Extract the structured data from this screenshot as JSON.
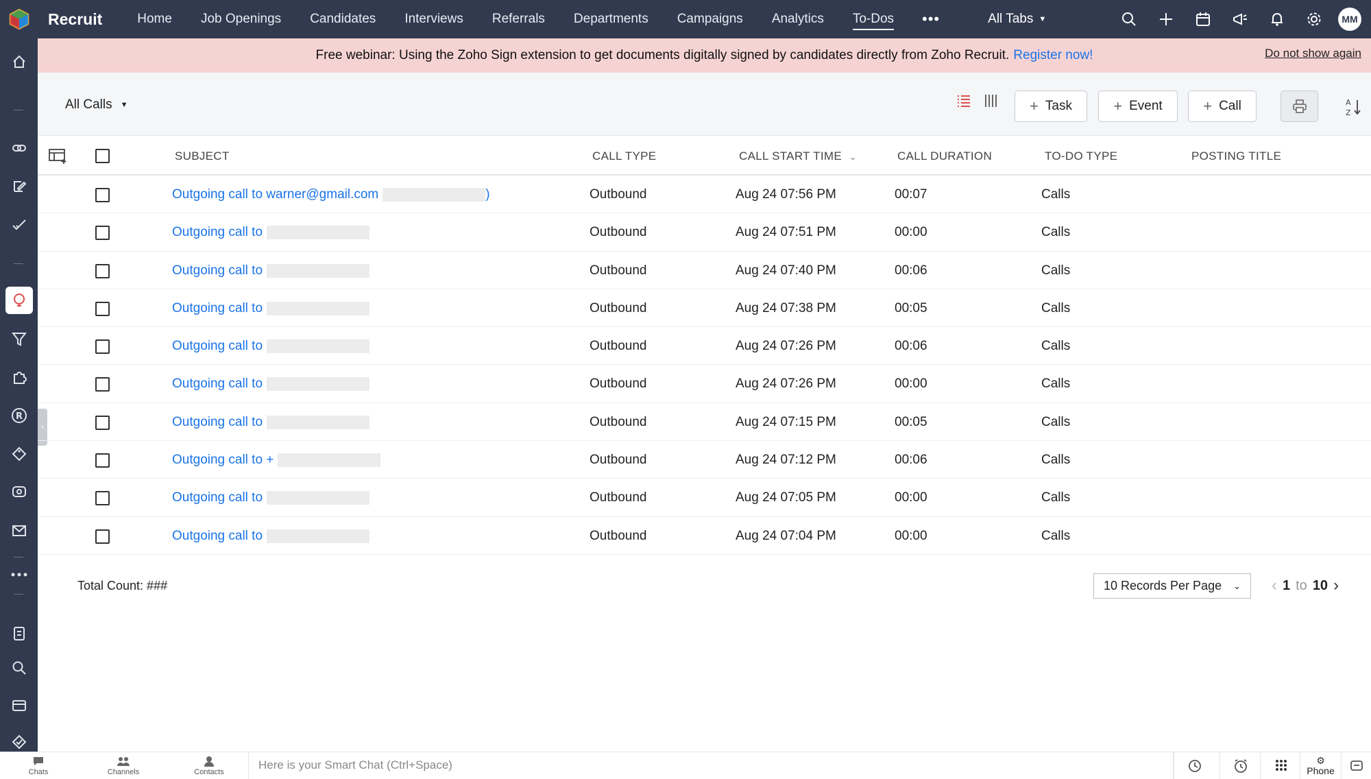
{
  "app": {
    "brand": "Recruit",
    "user_initials": "MM"
  },
  "nav": {
    "items": [
      "Home",
      "Job Openings",
      "Candidates",
      "Interviews",
      "Referrals",
      "Departments",
      "Campaigns",
      "Analytics",
      "To-Dos"
    ],
    "active": "To-Dos",
    "more": "•••",
    "all_tabs": "All Tabs"
  },
  "banner": {
    "text": "Free webinar: Using the Zoho Sign extension to get documents digitally signed by candidates directly from Zoho Recruit.",
    "link": "Register now!",
    "dismiss": "Do not show again"
  },
  "toolbar": {
    "view": "All Calls",
    "task_label": "Task",
    "event_label": "Event",
    "call_label": "Call"
  },
  "table": {
    "headers": {
      "subject": "SUBJECT",
      "call_type": "CALL TYPE",
      "call_start_time": "CALL START TIME",
      "call_duration": "CALL DURATION",
      "todo_type": "TO-DO TYPE",
      "posting_title": "POSTING TITLE"
    },
    "rows": [
      {
        "subject": "Outgoing call to warner@gmail.com",
        "suffix": ")",
        "call_type": "Outbound",
        "start": "Aug 24 07:56 PM",
        "duration": "00:07",
        "todo": "Calls"
      },
      {
        "subject": "Outgoing call to",
        "suffix": "",
        "call_type": "Outbound",
        "start": "Aug 24 07:51 PM",
        "duration": "00:00",
        "todo": "Calls"
      },
      {
        "subject": "Outgoing call to",
        "suffix": "",
        "call_type": "Outbound",
        "start": "Aug 24 07:40 PM",
        "duration": "00:06",
        "todo": "Calls"
      },
      {
        "subject": "Outgoing call to",
        "suffix": "",
        "call_type": "Outbound",
        "start": "Aug 24 07:38 PM",
        "duration": "00:05",
        "todo": "Calls"
      },
      {
        "subject": "Outgoing call to",
        "suffix": "",
        "call_type": "Outbound",
        "start": "Aug 24 07:26 PM",
        "duration": "00:06",
        "todo": "Calls"
      },
      {
        "subject": "Outgoing call to",
        "suffix": "",
        "call_type": "Outbound",
        "start": "Aug 24 07:26 PM",
        "duration": "00:00",
        "todo": "Calls"
      },
      {
        "subject": "Outgoing call to",
        "suffix": "",
        "call_type": "Outbound",
        "start": "Aug 24 07:15 PM",
        "duration": "00:05",
        "todo": "Calls"
      },
      {
        "subject": "Outgoing call to +",
        "suffix": "",
        "call_type": "Outbound",
        "start": "Aug 24 07:12 PM",
        "duration": "00:06",
        "todo": "Calls"
      },
      {
        "subject": "Outgoing call to",
        "suffix": "",
        "call_type": "Outbound",
        "start": "Aug 24 07:05 PM",
        "duration": "00:00",
        "todo": "Calls"
      },
      {
        "subject": "Outgoing call to",
        "suffix": "",
        "call_type": "Outbound",
        "start": "Aug 24 07:04 PM",
        "duration": "00:00",
        "todo": "Calls"
      }
    ]
  },
  "footer": {
    "total_count": "Total Count: ###",
    "per_page": "10 Records Per Page",
    "page_from": "1",
    "page_to_word": "to",
    "page_to": "10"
  },
  "bottombar": {
    "chats": "Chats",
    "channels": "Channels",
    "contacts": "Contacts",
    "smart_chat_placeholder": "Here is your Smart Chat (Ctrl+Space)",
    "phone": "Phone"
  },
  "colors": {
    "topbar": "#313a4f",
    "banner": "#f6d3d3",
    "link": "#1a73e8",
    "accent_red": "#e04d4d"
  }
}
